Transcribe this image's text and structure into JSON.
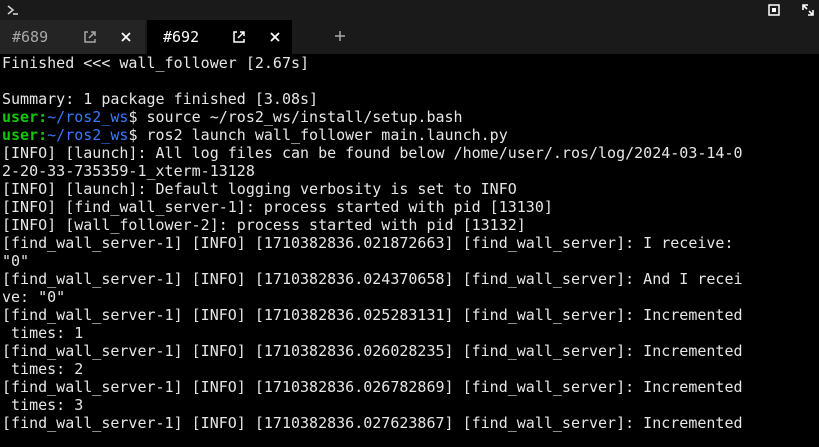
{
  "tabs": [
    {
      "label": "#689",
      "active": false
    },
    {
      "label": "#692",
      "active": true
    }
  ],
  "icons": {
    "app": "terminal-icon",
    "maximize": "maximize-icon",
    "expand": "expand-icon",
    "popout": "popout-icon",
    "close": "close-icon",
    "new_tab": "plus-icon"
  },
  "colors": {
    "prompt_user": "#16c60c",
    "prompt_path": "#3b78ff",
    "text": "#e6e6e6",
    "background": "#000000"
  },
  "terminal": {
    "lines": [
      {
        "text": "Finished <<< wall_follower [2.67s]"
      },
      {
        "text": ""
      },
      {
        "text": "Summary: 1 package finished [3.08s]"
      },
      {
        "prompt_user": "user:",
        "prompt_path": "~/ros2_ws",
        "prompt_symbol": "$ ",
        "command": "source ~/ros2_ws/install/setup.bash"
      },
      {
        "prompt_user": "user:",
        "prompt_path": "~/ros2_ws",
        "prompt_symbol": "$ ",
        "command": "ros2 launch wall_follower main.launch.py"
      },
      {
        "text": "[INFO] [launch]: All log files can be found below /home/user/.ros/log/2024-03-14-0"
      },
      {
        "text": "2-20-33-735359-1_xterm-13128"
      },
      {
        "text": "[INFO] [launch]: Default logging verbosity is set to INFO"
      },
      {
        "text": "[INFO] [find_wall_server-1]: process started with pid [13130]"
      },
      {
        "text": "[INFO] [wall_follower-2]: process started with pid [13132]"
      },
      {
        "text": "[find_wall_server-1] [INFO] [1710382836.021872663] [find_wall_server]: I receive:"
      },
      {
        "text": "\"0\""
      },
      {
        "text": "[find_wall_server-1] [INFO] [1710382836.024370658] [find_wall_server]: And I recei"
      },
      {
        "text": "ve: \"0\""
      },
      {
        "text": "[find_wall_server-1] [INFO] [1710382836.025283131] [find_wall_server]: Incremented"
      },
      {
        "text": " times: 1"
      },
      {
        "text": "[find_wall_server-1] [INFO] [1710382836.026028235] [find_wall_server]: Incremented"
      },
      {
        "text": " times: 2"
      },
      {
        "text": "[find_wall_server-1] [INFO] [1710382836.026782869] [find_wall_server]: Incremented"
      },
      {
        "text": " times: 3"
      },
      {
        "text": "[find_wall_server-1] [INFO] [1710382836.027623867] [find_wall_server]: Incremented"
      }
    ]
  }
}
